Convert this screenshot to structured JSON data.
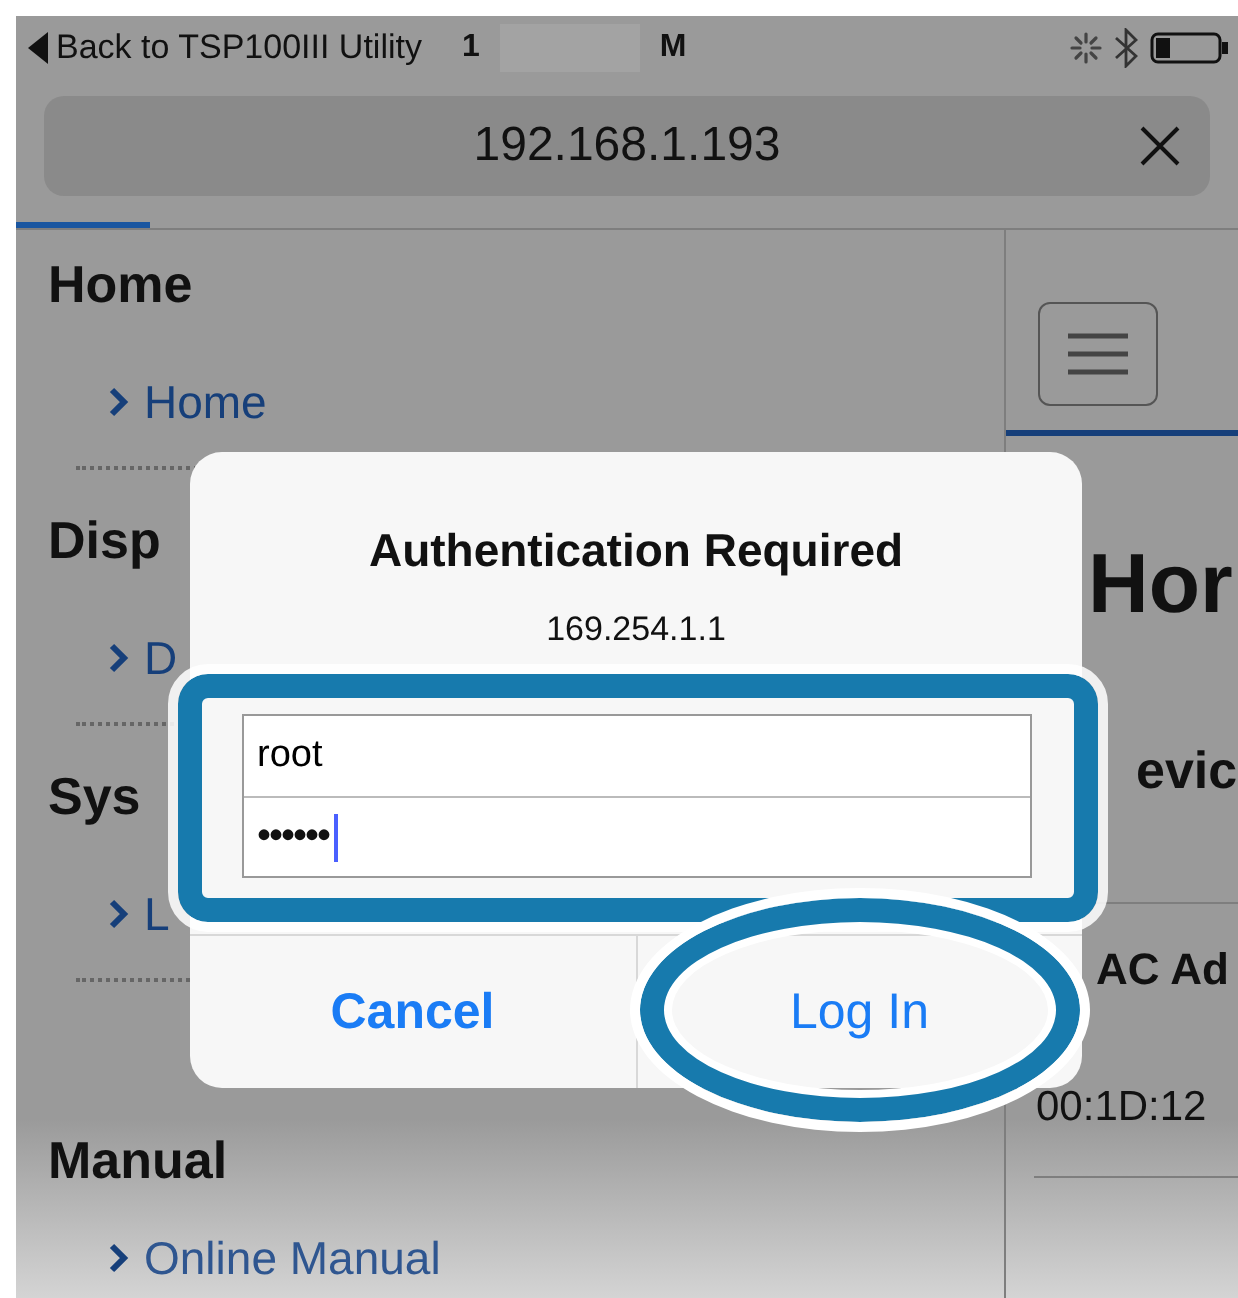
{
  "status_bar": {
    "back_label": "Back to TSP100III Utility",
    "time_start": "1",
    "time_end": "M"
  },
  "address_bar": {
    "url": "192.168.1.193"
  },
  "page_load": {
    "level": 0.11
  },
  "sidebar": {
    "sections": [
      {
        "heading": "Home",
        "items": [
          {
            "label": "Home"
          }
        ],
        "separator": true
      },
      {
        "heading": "Disp",
        "items": [
          {
            "label": "D"
          }
        ],
        "separator": true
      },
      {
        "heading": "Sys",
        "items": [
          {
            "label": "L"
          }
        ],
        "separator": true
      },
      {
        "heading": "Manual",
        "items": [
          {
            "label": "Online Manual"
          }
        ]
      }
    ]
  },
  "main": {
    "title": "Hor",
    "section_heading": "evic",
    "field_label": "AC Ad",
    "field_value": "00:1D:12"
  },
  "dialog": {
    "title": "Authentication Required",
    "host": "169.254.1.1",
    "username": {
      "value": "root"
    },
    "password": {
      "value": "••••••"
    },
    "buttons": [
      {
        "label": "Cancel",
        "kind": "cancel"
      },
      {
        "label": "Log In",
        "kind": "confirm"
      }
    ]
  },
  "annotations": [
    {
      "kind": "frame"
    },
    {
      "kind": "ellipse"
    }
  ]
}
